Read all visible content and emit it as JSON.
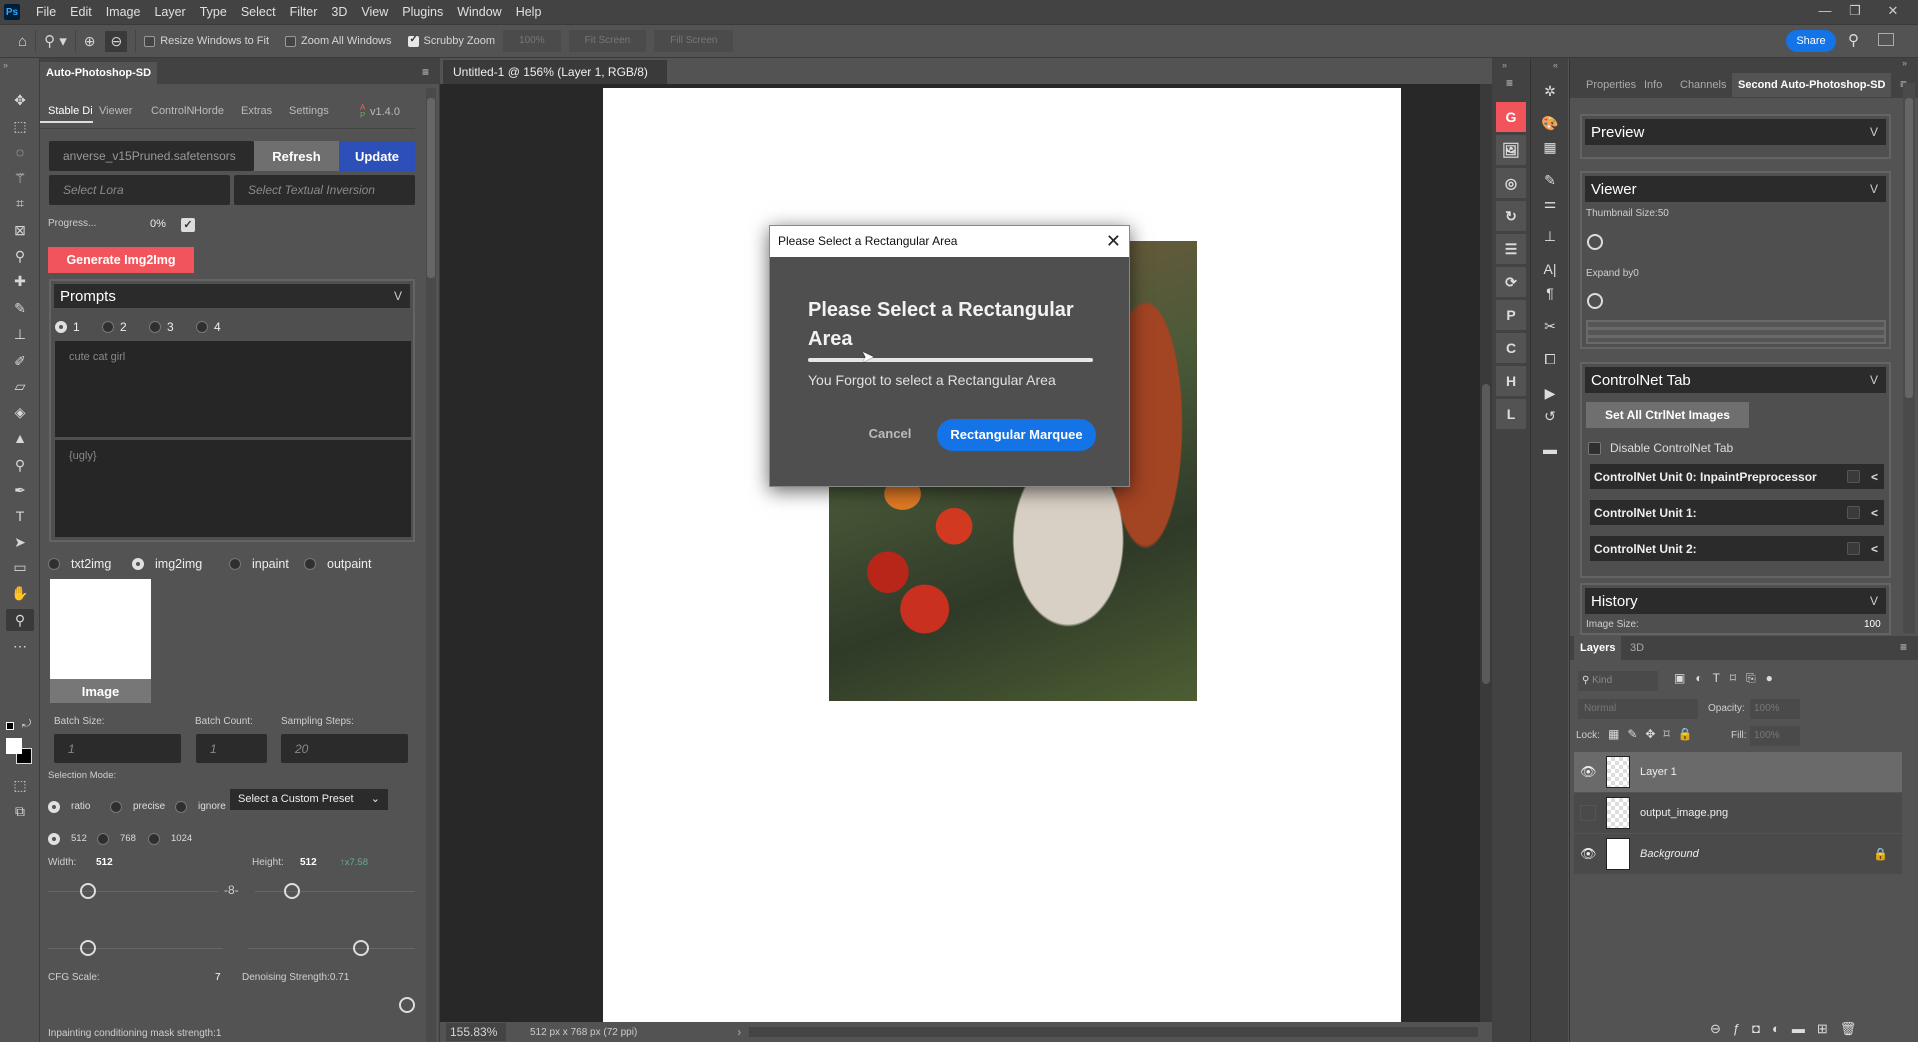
{
  "app": {
    "menu": [
      "File",
      "Edit",
      "Image",
      "Layer",
      "Type",
      "Select",
      "Filter",
      "3D",
      "View",
      "Plugins",
      "Window",
      "Help"
    ],
    "logo": "Ps"
  },
  "options": {
    "resize_windows": "Resize Windows to Fit",
    "zoom_all": "Zoom All Windows",
    "scrubby": "Scrubby Zoom",
    "zoom_pct": "100%",
    "fit_screen": "Fit Screen",
    "fill_screen": "Fill Screen",
    "share": "Share",
    "resize_checked": false,
    "zoom_all_checked": false,
    "scrubby_checked": true
  },
  "tools": [
    [
      "move-tool-icon",
      "✥"
    ],
    [
      "rectangular-marquee-icon",
      "⬚"
    ],
    [
      "lasso-icon",
      "◌"
    ],
    [
      "magic-wand-icon",
      "⚚"
    ],
    [
      "crop-icon",
      "⌗"
    ],
    [
      "frame-icon",
      "⊠"
    ],
    [
      "eyedropper-icon",
      "⚲"
    ],
    [
      "healing-brush-icon",
      "✚"
    ],
    [
      "brush-icon",
      "✎"
    ],
    [
      "clone-stamp-icon",
      "⊥"
    ],
    [
      "history-brush-icon",
      "✐"
    ],
    [
      "eraser-icon",
      "▱"
    ],
    [
      "paint-bucket-icon",
      "◈"
    ],
    [
      "blur-icon",
      "▲"
    ],
    [
      "dodge-icon",
      "⚲"
    ],
    [
      "pen-icon",
      "✒"
    ],
    [
      "type-icon",
      "T"
    ],
    [
      "path-selection-icon",
      "➤"
    ],
    [
      "rectangle-icon",
      "▭"
    ],
    [
      "hand-icon",
      "✋"
    ],
    [
      "zoom-icon",
      "⚲"
    ],
    [
      "more-tools-icon",
      "⋯"
    ]
  ],
  "plugin": {
    "title": "Auto-Photoshop-SD",
    "tabs": [
      "Stable Di",
      "Viewer",
      "ControlN",
      "Horde",
      "Extras",
      "Settings"
    ],
    "version": "v1.4.0",
    "model": "anverse_v15Pruned.safetensors",
    "refresh": "Refresh",
    "update": "Update",
    "lora_placeholder": "Select Lora",
    "ti_placeholder": "Select Textual Inversion",
    "progress_label": "Progress...",
    "progress_value": "0%",
    "progress_checked": true,
    "generate": "Generate Img2Img",
    "prompts_title": "Prompts",
    "prompt_slots": [
      "1",
      "2",
      "3",
      "4"
    ],
    "prompt_slot_selected": "1",
    "prompt": "cute cat girl",
    "negative_prompt": "{ugly}",
    "modes": [
      "txt2img",
      "img2img",
      "inpaint",
      "outpaint"
    ],
    "mode_selected": "img2img",
    "image_label": "Image",
    "batch_size_label": "Batch Size:",
    "batch_size": "1",
    "batch_count_label": "Batch Count:",
    "batch_count": "1",
    "steps_label": "Sampling Steps:",
    "steps": "20",
    "selection_mode_label": "Selection Mode:",
    "selection_modes": [
      "ratio",
      "precise",
      "ignore"
    ],
    "selection_selected": "ratio",
    "preset": "Select a Custom Preset",
    "sizes": [
      "512",
      "768",
      "1024"
    ],
    "size_selected": "512",
    "width_label": "Width:",
    "width": "512",
    "height_label": "Height:",
    "height": "512",
    "ratio": "↑x7.58",
    "cfg_label": "CFG Scale:",
    "cfg": "7",
    "denoise_label": "Denoising Strength:0.71",
    "mask_label": "Inpainting conditioning mask strength:1"
  },
  "document": {
    "tab": "Untitled-1 @ 156% (Layer 1, RGB/8) *",
    "zoom": "155.83%",
    "info": "512 px x 768 px (72 ppi)"
  },
  "dialog": {
    "window_title": "Please Select a Rectangular Area",
    "heading": "Please Select a Rectangular Area",
    "message": "You Forgot to select a Rectangular Area",
    "cancel": "Cancel",
    "confirm": "Rectangular Marquee",
    "accent": "#1473e6"
  },
  "strip1": [
    [
      "generate-icon",
      "G"
    ],
    [
      "image-icon",
      "🖼"
    ],
    [
      "camera-icon",
      "◎"
    ],
    [
      "rotate-icon",
      "↻"
    ],
    [
      "list-icon",
      "☰"
    ],
    [
      "refresh-frame-icon",
      "⟳"
    ],
    [
      "p-icon",
      "P"
    ],
    [
      "c-icon",
      "C"
    ],
    [
      "h-icon",
      "H"
    ],
    [
      "l-icon",
      "L"
    ]
  ],
  "strip2": [
    "learn-icon",
    "libraries-icon",
    "swatches-icon",
    "brush-settings-icon",
    "adjustments-icon",
    "clone-source-icon",
    "character-icon",
    "paragraph-icon",
    "tools-icon",
    "frame-icon",
    "actions-icon",
    "history-icon",
    "plugins-icon"
  ],
  "right": {
    "tabs": [
      "Properties",
      "Info",
      "Channels",
      "Second Auto-Photoshop-SD"
    ],
    "preview_title": "Preview",
    "viewer_title": "Viewer",
    "thumb_label": "Thumbnail Size:50",
    "expand_label": "Expand by0",
    "controlnet_title": "ControlNet Tab",
    "set_all": "Set All CtrlNet Images",
    "disable_cn": "Disable ControlNet Tab",
    "units": [
      "ControlNet Unit 0: InpaintPreprocessor",
      "ControlNet Unit 1:",
      "ControlNet Unit 2:"
    ],
    "history_title": "History",
    "image_size_label": "Image Size:",
    "image_size": "100"
  },
  "layers": {
    "tabs": [
      "Layers",
      "3D"
    ],
    "kind": "Kind",
    "blend": "Normal",
    "opacity_label": "Opacity:",
    "opacity": "100%",
    "lock_label": "Lock:",
    "fill_label": "Fill:",
    "fill": "100%",
    "items": [
      {
        "name": "Layer 1",
        "visible": true
      },
      {
        "name": "output_image.png",
        "visible": false
      },
      {
        "name": "Background",
        "visible": true
      }
    ]
  }
}
